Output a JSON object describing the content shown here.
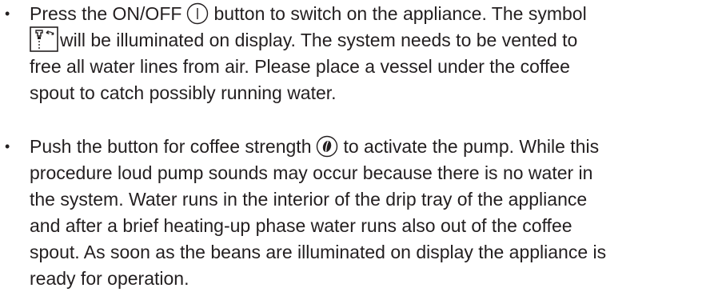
{
  "bullet_symbol": "•",
  "items": [
    {
      "lines": [
        [
          "Press the ON/OFF",
          "button to switch on the appliance. The symbol"
        ],
        "will be illuminated on display. The system needs to be vented to",
        "free all water lines from air. Please place a vessel under the coffee",
        "spout to catch possibly running water."
      ],
      "icons": [
        "on-off-button-icon",
        "brew-spout-icon"
      ]
    },
    {
      "lines": [
        [
          "Push the button for coffee strength",
          "to activate the pump. While this"
        ],
        "procedure loud pump sounds may occur because there is no water in",
        "the system. Water runs in the interior of the drip tray of the appliance",
        "and after a brief heating-up phase water runs also out of the coffee",
        "spout. As soon as the beans are illuminated on display the appliance is",
        "ready for operation."
      ],
      "icons": [
        "coffee-strength-bean-icon"
      ]
    }
  ],
  "colors": {
    "text": "#231f20",
    "background": "#ffffff"
  }
}
